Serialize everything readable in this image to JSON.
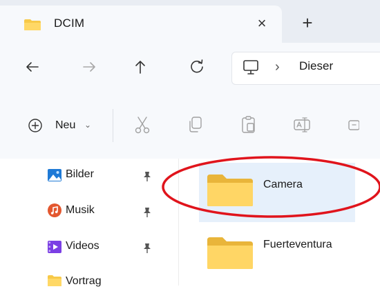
{
  "tab": {
    "title": "DCIM",
    "close_glyph": "×",
    "new_tab_glyph": "+"
  },
  "address": {
    "crumb_separator": "›",
    "crumb": "Dieser"
  },
  "toolbar": {
    "new_label": "Neu",
    "new_chevron": "⌄"
  },
  "nav": {
    "items": [
      {
        "label": "Bilder",
        "icon": "pictures-icon",
        "pinned": true
      },
      {
        "label": "Musik",
        "icon": "music-icon",
        "pinned": true
      },
      {
        "label": "Videos",
        "icon": "videos-icon",
        "pinned": true
      },
      {
        "label": "Vortrag",
        "icon": "folder-icon",
        "pinned": false
      }
    ]
  },
  "content": {
    "items": [
      {
        "name": "Camera",
        "selected": true
      },
      {
        "name": "Fuerteventura",
        "selected": false
      }
    ]
  },
  "colors": {
    "folder": "#f7c948",
    "selection": "#e6f0fb",
    "annotation": "#e0141c",
    "accent": "#0067c0"
  }
}
